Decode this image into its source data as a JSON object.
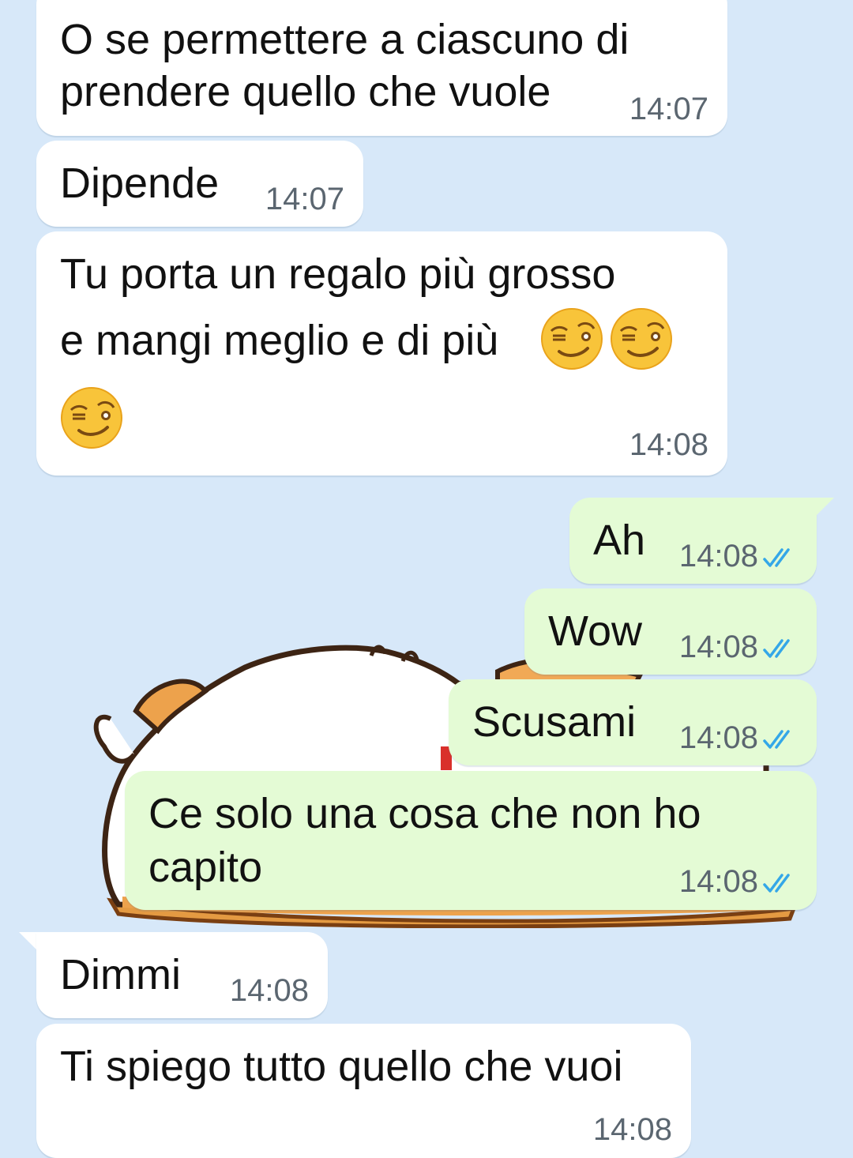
{
  "colors": {
    "background": "#d7e8f9",
    "incoming_bubble": "#ffffff",
    "outgoing_bubble": "#e4fbd5",
    "read_ticks": "#34a7e8",
    "timestamp": "#5b6670"
  },
  "messages": [
    {
      "direction": "incoming",
      "lines": [
        "O se permettere a ciascuno di",
        "prendere quello che vuole"
      ],
      "time": "14:07"
    },
    {
      "direction": "incoming",
      "lines": [
        "Dipende"
      ],
      "time": "14:07"
    },
    {
      "direction": "incoming",
      "lines": [
        "Tu porta un regalo più grosso",
        "e mangi meglio e di più"
      ],
      "emoji": "smirking-face",
      "time": "14:08"
    },
    {
      "direction": "outgoing",
      "lines": [
        "Ah"
      ],
      "time": "14:08",
      "status": "read-double-check-icon"
    },
    {
      "direction": "outgoing",
      "lines": [
        "Wow"
      ],
      "time": "14:08",
      "status": "read-double-check-icon"
    },
    {
      "direction": "outgoing",
      "lines": [
        "Scusami"
      ],
      "time": "14:08",
      "status": "read-double-check-icon"
    },
    {
      "direction": "outgoing",
      "lines": [
        "Ce solo una cosa che non ho",
        "capito"
      ],
      "time": "14:08",
      "status": "read-double-check-icon"
    },
    {
      "direction": "incoming",
      "lines": [
        "Dimmi"
      ],
      "time": "14:08"
    },
    {
      "direction": "incoming",
      "lines": [
        "Ti spiego tutto quello che vuoi"
      ],
      "time": "14:08"
    }
  ],
  "sticker": {
    "icon": "sleeping-hamster-sticker"
  }
}
